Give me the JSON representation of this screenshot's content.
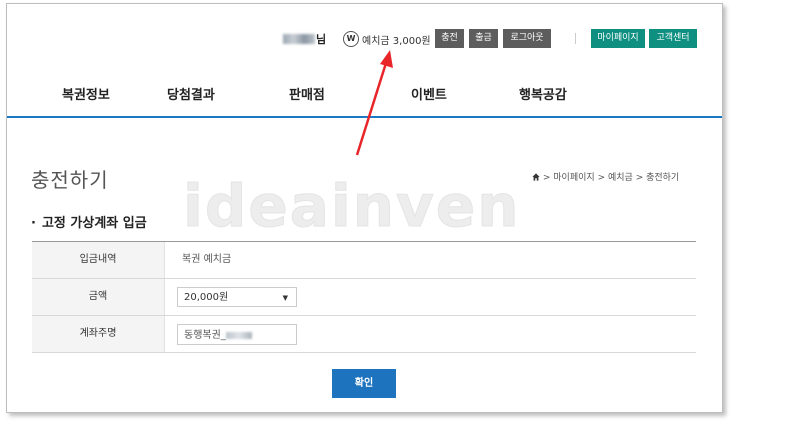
{
  "header": {
    "user_suffix": "님",
    "won_symbol": "W",
    "deposit_label": "예치금",
    "deposit_amount": "3,000원",
    "buttons": {
      "charge": "충전",
      "withdraw": "출금",
      "logout": "로그아웃",
      "mypage": "마이페이지",
      "support": "고객센터"
    }
  },
  "nav": {
    "items": [
      "복권정보",
      "당첨결과",
      "판매점",
      "이벤트",
      "행복공감"
    ]
  },
  "page": {
    "title": "충전하기",
    "breadcrumb": [
      "마이페이지",
      "예치금",
      "충전하기"
    ],
    "section_title": "고정 가상계좌 입금",
    "section_bullet": "·"
  },
  "form": {
    "rows": [
      {
        "label": "입금내역",
        "value": "복권 예치금"
      },
      {
        "label": "금액",
        "selected": "20,000원"
      },
      {
        "label": "계좌주명",
        "value": "동행복권_"
      }
    ],
    "confirm_label": "확인"
  },
  "watermark": "ideainven",
  "colors": {
    "nav_underline": "#1c78c2",
    "primary_button": "#1d73bd",
    "green_button": "#0e8f80",
    "gray_button": "#5d5d5d",
    "annotation_arrow": "#e8262a"
  }
}
